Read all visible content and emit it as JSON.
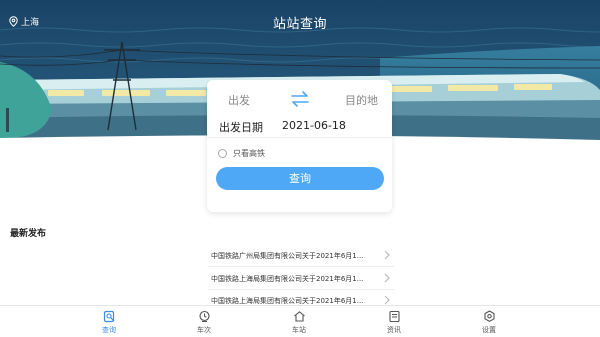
{
  "header": {
    "location": "上海",
    "title": "站站查询"
  },
  "search": {
    "from_label": "出发",
    "to_label": "目的地",
    "date_label": "出发日期",
    "date_value": "2021-06-18",
    "high_speed_only": "只看高铁",
    "high_speed_checked": false,
    "query_button": "查询"
  },
  "news": {
    "heading": "最新发布",
    "items": [
      "中国铁路广州局集团有限公司关于2021年6月1...",
      "中国铁路上海局集团有限公司关于2021年6月1...",
      "中国铁路上海局集团有限公司关于2021年6月1..."
    ]
  },
  "tabbar": {
    "tabs": [
      {
        "label": "查询",
        "icon": "search-doc-icon",
        "active": true
      },
      {
        "label": "车次",
        "icon": "clock-icon",
        "active": false
      },
      {
        "label": "车站",
        "icon": "station-icon",
        "active": false
      },
      {
        "label": "资讯",
        "icon": "news-icon",
        "active": false
      },
      {
        "label": "设置",
        "icon": "settings-icon",
        "active": false
      }
    ]
  },
  "colors": {
    "accent": "#4fa8f5",
    "tab_active": "#3b8de6",
    "banner_dark": "#1d4a6b",
    "banner_sea": "#2e6d8e"
  }
}
